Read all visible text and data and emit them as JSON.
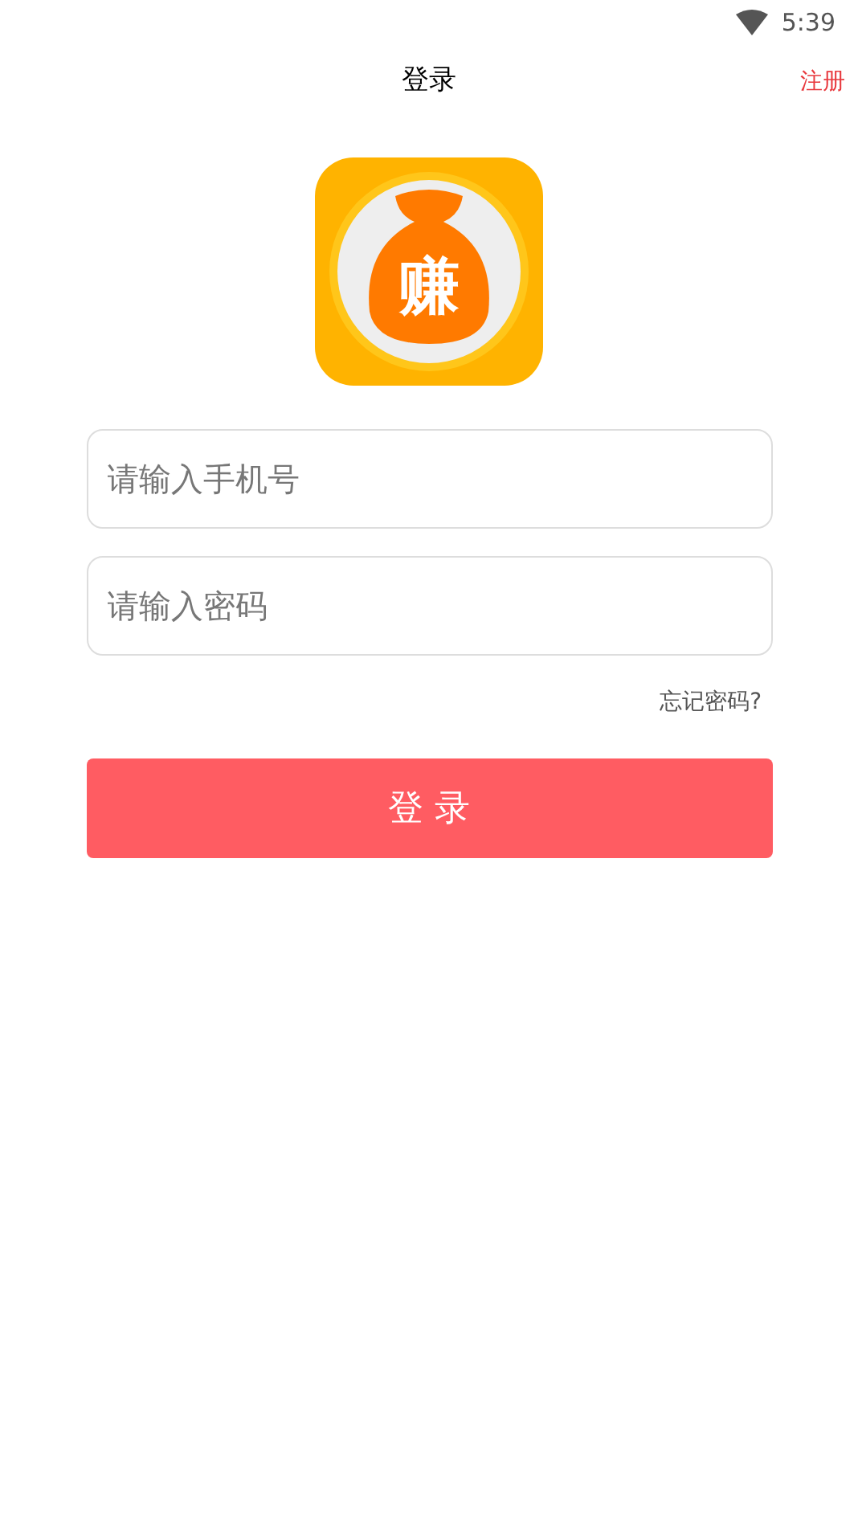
{
  "status_bar": {
    "time": "5:39"
  },
  "header": {
    "title": "登录",
    "action": "注册"
  },
  "logo": {
    "text": "赚"
  },
  "fields": [
    {
      "placeholder": "请输入手机号"
    },
    {
      "placeholder": "请输入密码"
    }
  ],
  "forgot_link": "忘记密码?",
  "login_button": "登 录"
}
